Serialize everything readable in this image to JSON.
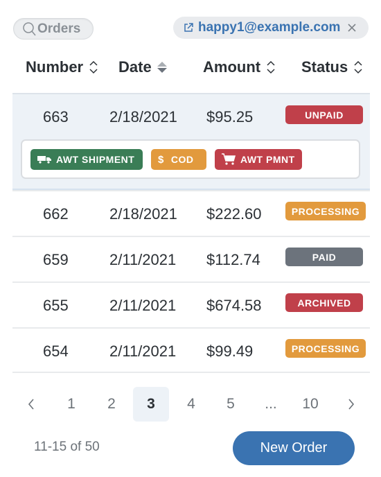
{
  "filters": {
    "search_chip": {
      "label": "Orders",
      "icon": "search-icon"
    },
    "user_chip": {
      "label": "happy1@example.com",
      "icon": "external-link-icon",
      "close_icon": "close-icon"
    }
  },
  "table": {
    "columns": [
      {
        "label": "Number",
        "sort": "none"
      },
      {
        "label": "Date",
        "sort": "active"
      },
      {
        "label": "Amount",
        "sort": "none"
      },
      {
        "label": "Status",
        "sort": "none"
      }
    ],
    "rows": [
      {
        "number": "663",
        "date": "2/18/2021",
        "amount": "$95.25",
        "status": "UNPAID",
        "status_color": "#c0404a",
        "selected": true,
        "tags": [
          {
            "label": "AWT SHIPMENT",
            "icon": "truck-icon",
            "color": "#3a7d56"
          },
          {
            "label": "COD",
            "icon": "dollar-icon",
            "color": "#e29a3d"
          },
          {
            "label": "AWT PMNT",
            "icon": "cart-icon",
            "color": "#c0404a"
          }
        ]
      },
      {
        "number": "662",
        "date": "2/18/2021",
        "amount": "$222.60",
        "status": "PROCESSING",
        "status_color": "#e29a3d"
      },
      {
        "number": "659",
        "date": "2/11/2021",
        "amount": "$112.74",
        "status": "PAID",
        "status_color": "#6c737c"
      },
      {
        "number": "655",
        "date": "2/11/2021",
        "amount": "$674.58",
        "status": "ARCHIVED",
        "status_color": "#c0404a"
      },
      {
        "number": "654",
        "date": "2/11/2021",
        "amount": "$99.49",
        "status": "PROCESSING",
        "status_color": "#e29a3d"
      }
    ]
  },
  "pagination": {
    "pages": [
      "1",
      "2",
      "3",
      "4",
      "5",
      "...",
      "10"
    ],
    "current": "3",
    "range_text": "11-15 of 50"
  },
  "actions": {
    "new_order_label": "New Order"
  },
  "colors": {
    "accent": "#3a73b1",
    "selected_row": "#edf2f7"
  }
}
